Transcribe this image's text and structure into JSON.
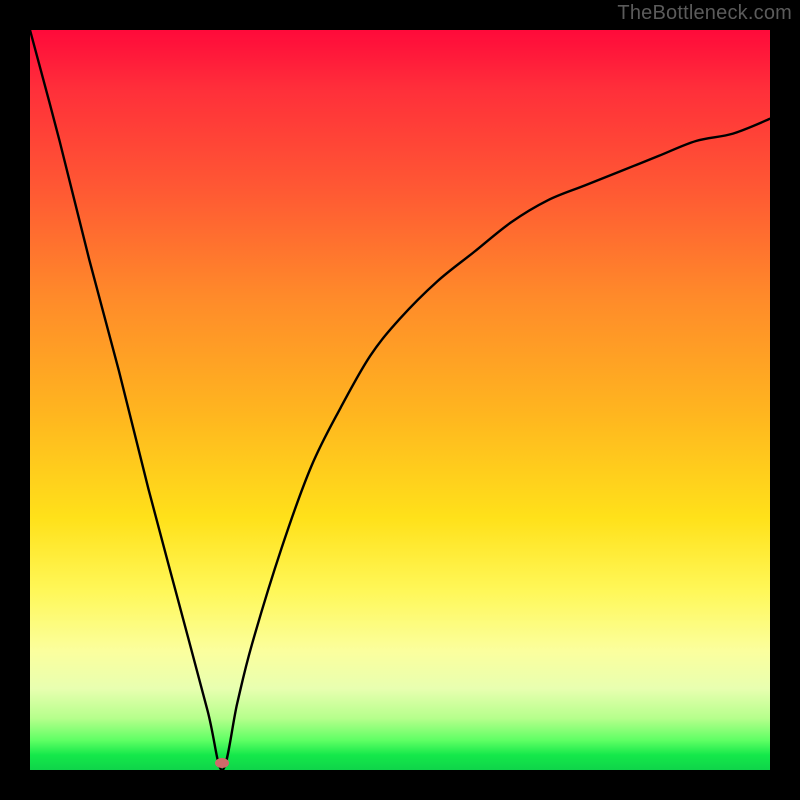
{
  "watermark": "TheBottleneck.com",
  "colors": {
    "frame": "#000000",
    "curve": "#000000",
    "marker": "#cf6a6a",
    "gradient_stops": [
      "#ff0a3a",
      "#ff2f3a",
      "#ff5a33",
      "#ff8a2a",
      "#ffb61f",
      "#ffe11a",
      "#fff85a",
      "#fbff9e",
      "#e8ffb0",
      "#b6ff8c",
      "#5fff64",
      "#14e84a",
      "#0fd44a"
    ]
  },
  "chart_data": {
    "type": "line",
    "title": "",
    "xlabel": "",
    "ylabel": "",
    "xlim": [
      0,
      100
    ],
    "ylim": [
      0,
      100
    ],
    "grid": false,
    "legend": false,
    "marker": {
      "x": 26,
      "y": 1
    },
    "comment": "y expressed as percent of plot height (0 at bottom, 100 at top). Curve: steep near-linear drop from top-left to a sharp minimum near x≈26, then a concave rise toward ~88% at the right edge.",
    "series": [
      {
        "name": "curve",
        "x": [
          0,
          4,
          8,
          12,
          16,
          20,
          24,
          26,
          28,
          30,
          34,
          38,
          42,
          46,
          50,
          55,
          60,
          65,
          70,
          75,
          80,
          85,
          90,
          95,
          100
        ],
        "values": [
          100,
          85,
          69,
          54,
          38,
          23,
          8,
          0,
          9,
          17,
          30,
          41,
          49,
          56,
          61,
          66,
          70,
          74,
          77,
          79,
          81,
          83,
          85,
          86,
          88
        ]
      }
    ]
  }
}
